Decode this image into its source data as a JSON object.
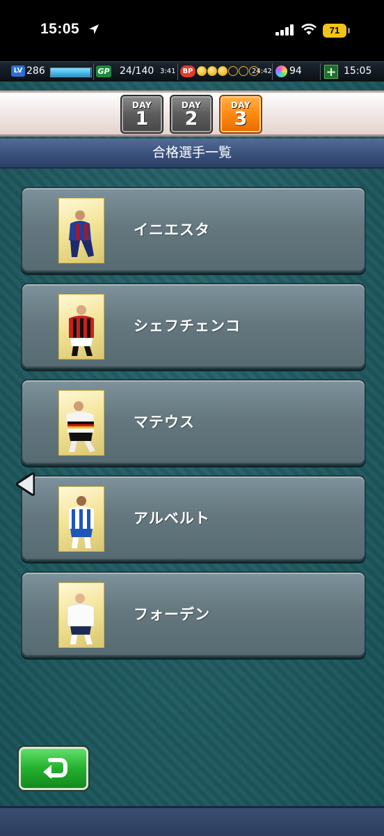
{
  "status_bar": {
    "time": "15:05",
    "battery": "71"
  },
  "hud": {
    "level_icon": "LV",
    "level": "286",
    "exp_progress": 0.98,
    "gp_icon": "GP",
    "gp": "24/140",
    "gp_timer": "3:41",
    "bp_icon": "BP",
    "bp_full": 3,
    "bp_max": 6,
    "bp_timer": "24:42",
    "gems": "94",
    "clock": "15:05"
  },
  "day_tabs": [
    {
      "label": "DAY",
      "num": "1",
      "active": false
    },
    {
      "label": "DAY",
      "num": "2",
      "active": false
    },
    {
      "label": "DAY",
      "num": "3",
      "active": true
    }
  ],
  "page_title": "合格選手一覧",
  "players": [
    {
      "name": "イニエスタ",
      "kit": "barcelona"
    },
    {
      "name": "シェフチェンコ",
      "kit": "milan"
    },
    {
      "name": "マテウス",
      "kit": "germany"
    },
    {
      "name": "アルベルト",
      "kit": "porto"
    },
    {
      "name": "フォーデン",
      "kit": "england"
    }
  ],
  "colors": {
    "accent_active_tab": "#ff8a12",
    "back_button": "#24b02f",
    "title_bar": "#3a517b"
  }
}
